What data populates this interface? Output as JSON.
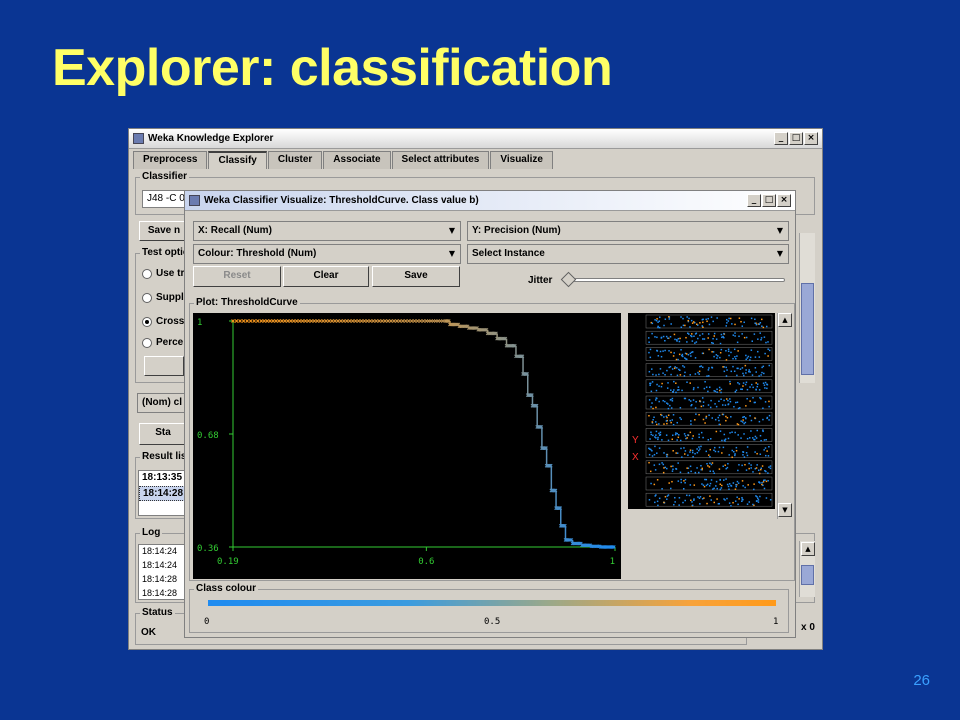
{
  "slide": {
    "title": "Explorer: classification",
    "page_number": "26"
  },
  "main_window": {
    "title": "Weka Knowledge Explorer",
    "win_buttons": {
      "minimize": "_",
      "maximize": "□",
      "close": "×"
    },
    "tabs": [
      "Preprocess",
      "Classify",
      "Cluster",
      "Associate",
      "Select attributes",
      "Visualize"
    ],
    "selected_tab": "Classify",
    "classifier": {
      "group_label": "Classifier",
      "value": "J48 -C 0"
    },
    "save_button": "Save n",
    "test_options": {
      "group_label": "Test optio",
      "options": [
        {
          "label": "Use tr",
          "checked": false
        },
        {
          "label": "Suppl",
          "checked": false
        },
        {
          "label": "Cross",
          "checked": true
        },
        {
          "label": "Perce",
          "checked": false
        }
      ]
    },
    "class_select": "(Nom) cl",
    "start_button": "Sta",
    "result_list": {
      "group_label": "Result lis",
      "items": [
        {
          "label": "18:13:35",
          "selected": false
        },
        {
          "label": "18:14:28",
          "selected": true
        }
      ]
    },
    "log": {
      "group_label": "Log",
      "lines": [
        "18:14:24",
        "18:14:24",
        "18:14:28",
        "18:14:28"
      ]
    },
    "status": {
      "group_label": "Status",
      "text": "OK"
    },
    "right_edge_text": "x 0"
  },
  "viz_window": {
    "title": "Weka Classifier Visualize: ThresholdCurve. Class value b)",
    "win_buttons": {
      "minimize": "_",
      "maximize": "□",
      "close": "×"
    },
    "x_axis_select": "X: Recall (Num)",
    "y_axis_select": "Y: Precision (Num)",
    "colour_select": "Colour: Threshold (Num)",
    "instance_select": "Select Instance",
    "buttons": {
      "reset": "Reset",
      "clear": "Clear",
      "save": "Save"
    },
    "jitter_label": "Jitter",
    "jitter_value": 0,
    "plot_group_label": "Plot: ThresholdCurve",
    "class_colour_label": "Class colour",
    "class_colour_ticks": [
      "0",
      "0.5",
      "1"
    ],
    "attribute_panel_labels": {
      "y": "Y",
      "x": "X"
    },
    "colors": {
      "low": "#1f8bf0",
      "high": "#ff9a1a",
      "axis": "#33cc33",
      "background": "#000000"
    },
    "strips": [
      {
        "orange_share": 0.25
      },
      {
        "orange_share": 0.1
      },
      {
        "orange_share": 0.12
      },
      {
        "orange_share": 0.05
      },
      {
        "orange_share": 0.08
      },
      {
        "orange_share": 0.1
      },
      {
        "orange_share": 0.35
      },
      {
        "orange_share": 0.08
      },
      {
        "orange_share": 0.15
      },
      {
        "orange_share": 0.2
      },
      {
        "orange_share": 0.18
      },
      {
        "orange_share": 0.12
      }
    ]
  },
  "chart_data": {
    "type": "scatter",
    "title": "",
    "xlabel": "Recall",
    "ylabel": "Precision",
    "xlim": [
      0.19,
      1
    ],
    "ylim": [
      0.36,
      1
    ],
    "x_ticks": [
      "0.19",
      "0.6",
      "1"
    ],
    "y_ticks": [
      "1",
      "0.68",
      "0.36"
    ],
    "colour_by": "Threshold",
    "series": [
      {
        "x": [
          0.19,
          0.25,
          0.3,
          0.35,
          0.4,
          0.45,
          0.5,
          0.55,
          0.6,
          0.64,
          0.66,
          0.68,
          0.7,
          0.72,
          0.74,
          0.76,
          0.78,
          0.8,
          0.81,
          0.82,
          0.83,
          0.84,
          0.85,
          0.86,
          0.87,
          0.88,
          0.89,
          0.9,
          0.92,
          0.94,
          0.96,
          0.98,
          1.0
        ],
        "y": [
          1.0,
          1.0,
          1.0,
          1.0,
          1.0,
          1.0,
          1.0,
          1.0,
          1.0,
          1.0,
          0.99,
          0.985,
          0.98,
          0.975,
          0.965,
          0.95,
          0.93,
          0.9,
          0.85,
          0.79,
          0.76,
          0.7,
          0.64,
          0.59,
          0.52,
          0.47,
          0.42,
          0.38,
          0.37,
          0.365,
          0.362,
          0.36,
          0.36
        ],
        "threshold": [
          1.0,
          0.97,
          0.94,
          0.91,
          0.88,
          0.85,
          0.82,
          0.79,
          0.76,
          0.72,
          0.68,
          0.64,
          0.6,
          0.57,
          0.54,
          0.5,
          0.46,
          0.43,
          0.4,
          0.37,
          0.34,
          0.31,
          0.28,
          0.25,
          0.22,
          0.19,
          0.16,
          0.13,
          0.1,
          0.07,
          0.05,
          0.02,
          0.0
        ]
      }
    ]
  }
}
